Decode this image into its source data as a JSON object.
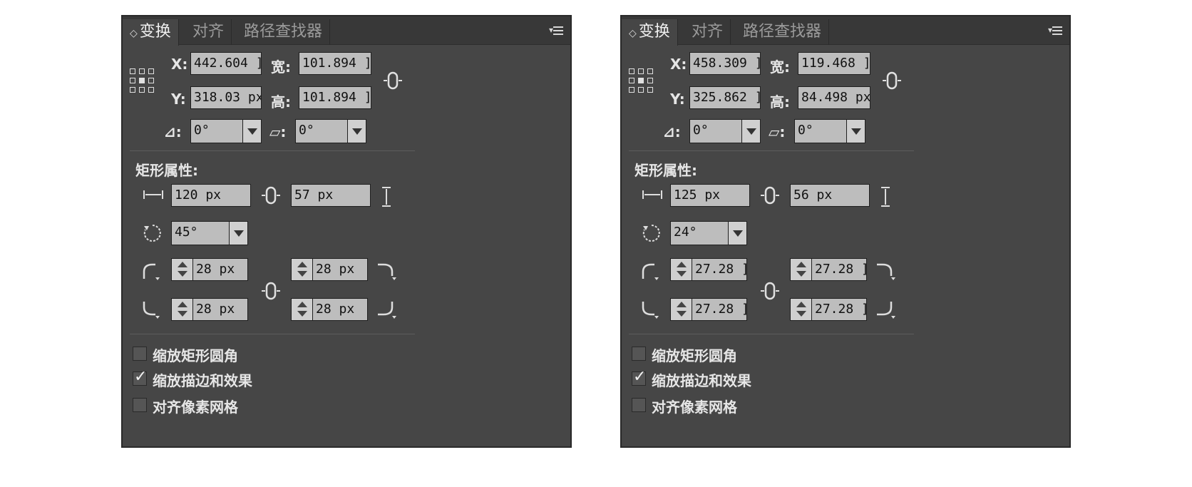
{
  "panels": [
    {
      "tabs": {
        "transform": "变换",
        "align": "对齐",
        "pathfinder": "路径查找器",
        "arrows": "◇"
      },
      "transform": {
        "x_label": "X:",
        "x_value": "442.604 ]",
        "y_label": "Y:",
        "y_value": "318.03 px",
        "w_label": "宽:",
        "w_value": "101.894 ]",
        "h_label": "高:",
        "h_value": "101.894 ]",
        "rotate_value": "0°",
        "shear_value": "0°",
        "rotate_label": "⊿:",
        "shear_label": "▱:"
      },
      "rect": {
        "title": "矩形属性:",
        "width_value": "120 px",
        "height_value": "57 px",
        "angle_value": "45°",
        "corner_tl": "28 px",
        "corner_tr": "28 px",
        "corner_bl": "28 px",
        "corner_br": "28 px"
      },
      "options": {
        "scale_corners": "缩放矩形圆角",
        "scale_strokes": "缩放描边和效果",
        "align_pixel": "对齐像素网格",
        "scale_corners_checked": false,
        "scale_strokes_checked": true,
        "align_pixel_checked": false
      }
    },
    {
      "tabs": {
        "transform": "变换",
        "align": "对齐",
        "pathfinder": "路径查找器",
        "arrows": "◇"
      },
      "transform": {
        "x_label": "X:",
        "x_value": "458.309 ]",
        "y_label": "Y:",
        "y_value": "325.862 ]",
        "w_label": "宽:",
        "w_value": "119.468 ]",
        "h_label": "高:",
        "h_value": "84.498 px",
        "rotate_value": "0°",
        "shear_value": "0°",
        "rotate_label": "⊿:",
        "shear_label": "▱:"
      },
      "rect": {
        "title": "矩形属性:",
        "width_value": "125 px",
        "height_value": "56 px",
        "angle_value": "24°",
        "corner_tl": "27.28 ]",
        "corner_tr": "27.28 ]",
        "corner_bl": "27.28 ]",
        "corner_br": "27.28 ]"
      },
      "options": {
        "scale_corners": "缩放矩形圆角",
        "scale_strokes": "缩放描边和效果",
        "align_pixel": "对齐像素网格",
        "scale_corners_checked": false,
        "scale_strokes_checked": true,
        "align_pixel_checked": false
      }
    }
  ],
  "tick_glyph": "✓",
  "colors": {
    "panel_bg": "#464646",
    "field_bg": "#bdbdbd",
    "tab_bg": "#383838"
  }
}
